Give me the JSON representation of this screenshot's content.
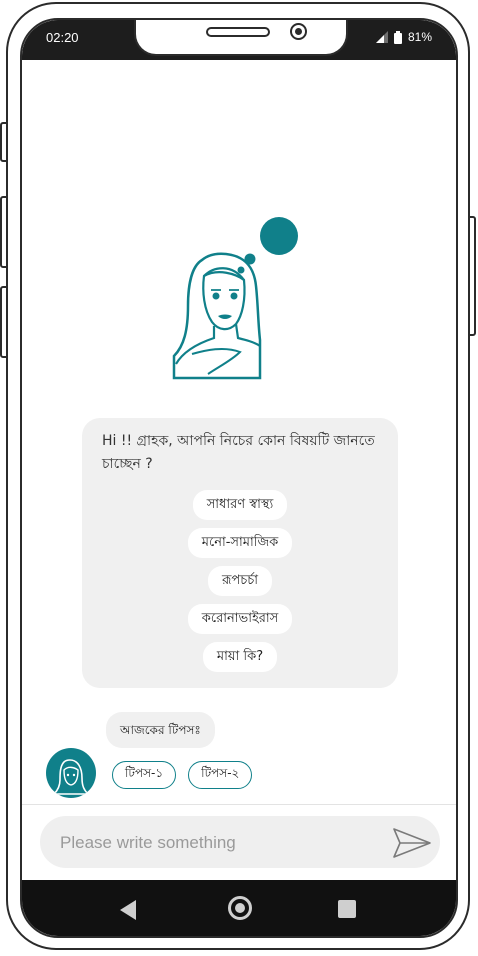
{
  "status_bar": {
    "time": "02:20",
    "battery": "81%",
    "icons": [
      "signal-icon",
      "battery-icon"
    ]
  },
  "bot_message": {
    "text": "Hi !! গ্রাহক, আপনি নিচের কোন বিষয়টি জানতে চাচ্ছেন ?",
    "options": [
      "সাধারণ স্বাস্থ্য",
      "মনো-সামাজিক",
      "রূপচর্চা",
      "করোনাভাইরাস",
      "মায়া কি?"
    ]
  },
  "tips": {
    "label": "আজকের টিপসঃ",
    "chips": [
      "টিপস-১",
      "টিপস-২"
    ]
  },
  "composer": {
    "placeholder": "Please write something"
  },
  "colors": {
    "accent": "#10808a",
    "bubble": "#f0f0f0",
    "nav_bar": "#111111"
  }
}
